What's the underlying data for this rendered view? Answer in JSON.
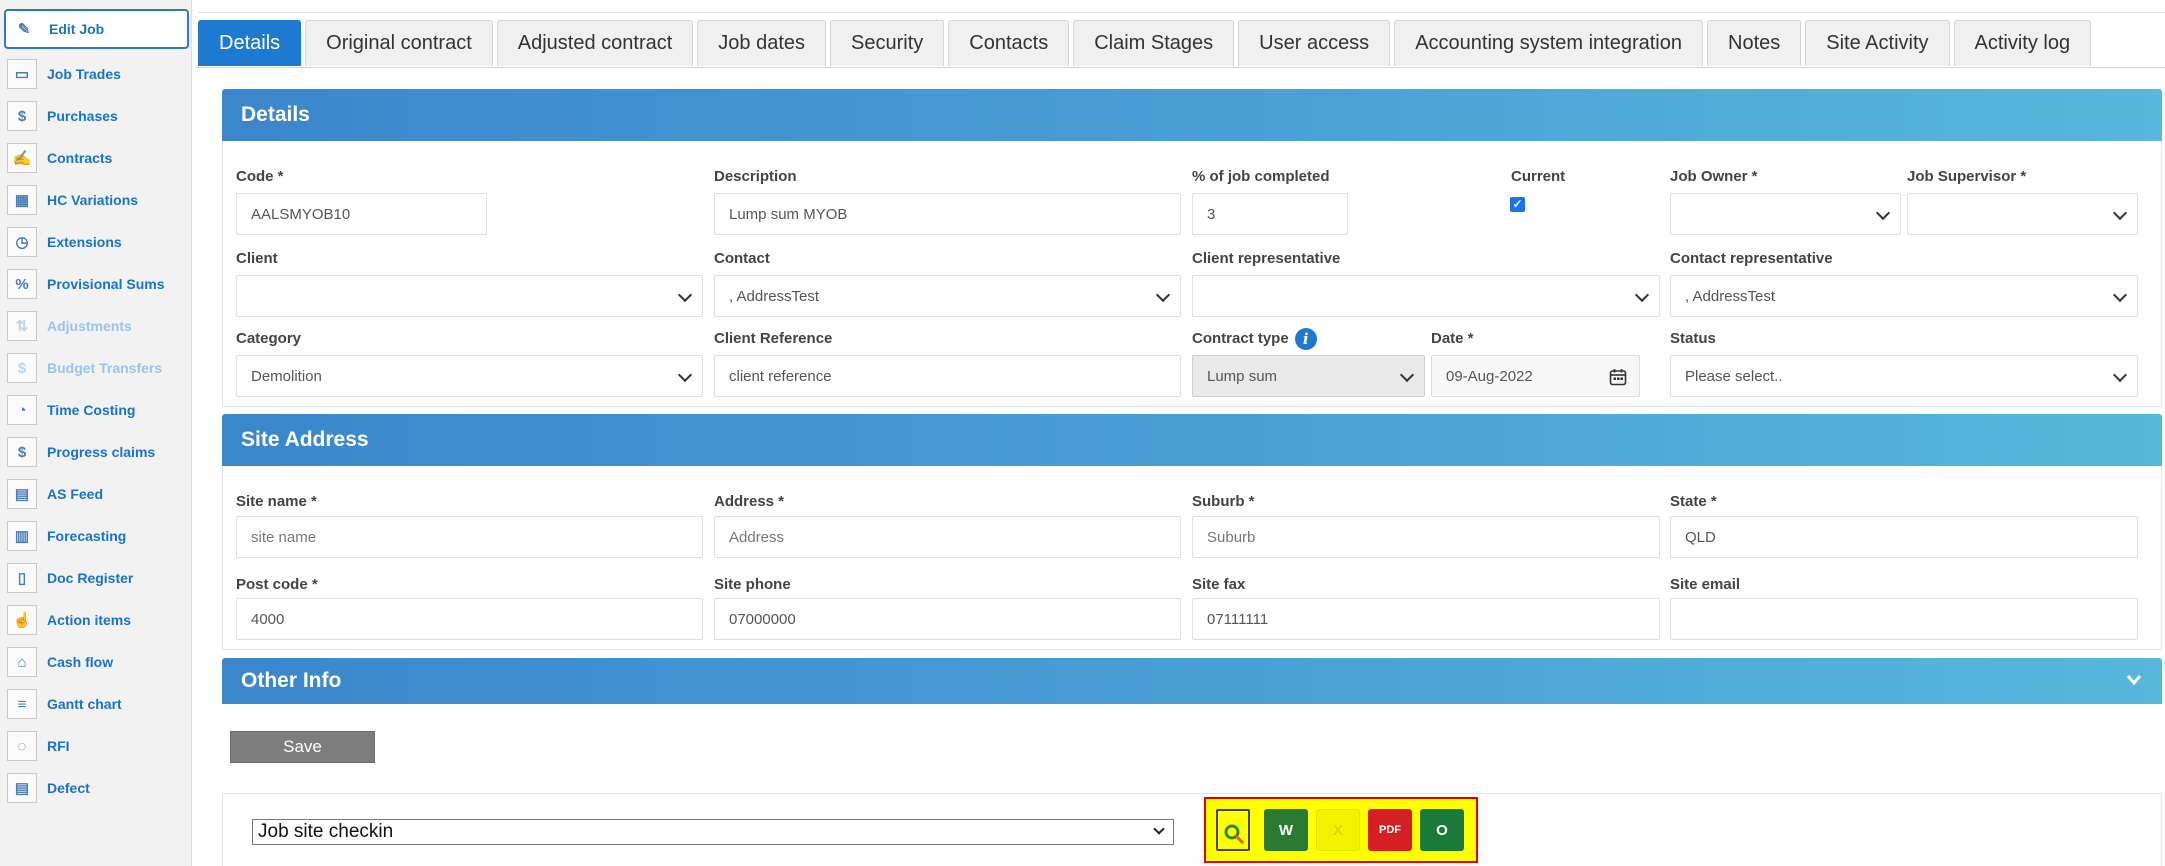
{
  "sidebar": {
    "items": [
      {
        "label": "Edit Job",
        "icon": "pencil-icon",
        "glyph": "✎"
      },
      {
        "label": "Job Trades",
        "icon": "folder-icon",
        "glyph": "▭"
      },
      {
        "label": "Purchases",
        "icon": "coins-icon",
        "glyph": "$"
      },
      {
        "label": "Contracts",
        "icon": "contract-icon",
        "glyph": "✍"
      },
      {
        "label": "HC Variations",
        "icon": "variations-icon",
        "glyph": "▦"
      },
      {
        "label": "Extensions",
        "icon": "clock-icon",
        "glyph": "◷"
      },
      {
        "label": "Provisional Sums",
        "icon": "sums-icon",
        "glyph": "%"
      },
      {
        "label": "Adjustments",
        "icon": "adjust-icon",
        "glyph": "⇅"
      },
      {
        "label": "Budget Transfers",
        "icon": "transfer-icon",
        "glyph": "$"
      },
      {
        "label": "Time Costing",
        "icon": "time-costing-icon",
        "glyph": "◔"
      },
      {
        "label": "Progress claims",
        "icon": "claims-icon",
        "glyph": "$"
      },
      {
        "label": "AS Feed",
        "icon": "feed-icon",
        "glyph": "▤"
      },
      {
        "label": "Forecasting",
        "icon": "forecast-chart-icon",
        "glyph": "▥"
      },
      {
        "label": "Doc Register",
        "icon": "document-icon",
        "glyph": "▯"
      },
      {
        "label": "Action items",
        "icon": "action-icon",
        "glyph": "☝"
      },
      {
        "label": "Cash flow",
        "icon": "cash-icon",
        "glyph": "⌂"
      },
      {
        "label": "Gantt chart",
        "icon": "gantt-icon",
        "glyph": "≡"
      },
      {
        "label": "RFI",
        "icon": "rfi-icon",
        "glyph": "◌"
      },
      {
        "label": "Defect",
        "icon": "defect-icon",
        "glyph": "▤"
      }
    ]
  },
  "tabs": [
    "Details",
    "Original contract",
    "Adjusted contract",
    "Job dates",
    "Security",
    "Contacts",
    "Claim Stages",
    "User access",
    "Accounting system integration",
    "Notes",
    "Site Activity",
    "Activity log"
  ],
  "details": {
    "title": "Details",
    "code_label": "Code *",
    "code_value": "AALSMYOB10",
    "description_label": "Description",
    "description_value": "Lump sum MYOB",
    "percent_label": "% of job completed",
    "percent_value": "3",
    "current_label": "Current",
    "current_checked": true,
    "owner_label": "Job Owner *",
    "owner_value": "",
    "supervisor_label": "Job Supervisor *",
    "supervisor_value": "",
    "client_label": "Client",
    "client_value": "",
    "contact_label": "Contact",
    "contact_value": ", AddressTest",
    "client_rep_label": "Client representative",
    "client_rep_value": "",
    "contact_rep_label": "Contact representative",
    "contact_rep_value": ", AddressTest",
    "category_label": "Category",
    "category_value": "Demolition",
    "client_ref_label": "Client Reference",
    "client_ref_value": "client reference",
    "contract_type_label": "Contract type",
    "contract_type_value": "Lump sum",
    "date_label": "Date *",
    "date_value": "09-Aug-2022",
    "status_label": "Status",
    "status_value": "Please select.."
  },
  "site": {
    "title": "Site Address",
    "site_name_label": "Site name *",
    "site_name_placeholder": "site name",
    "address_label": "Address *",
    "address_placeholder": "Address",
    "suburb_label": "Suburb *",
    "suburb_placeholder": "Suburb",
    "state_label": "State *",
    "state_value": "QLD",
    "postcode_label": "Post code *",
    "postcode_value": "4000",
    "phone_label": "Site phone",
    "phone_value": "07000000",
    "fax_label": "Site fax",
    "fax_value": "07111111",
    "email_label": "Site email",
    "email_value": ""
  },
  "other": {
    "title": "Other Info"
  },
  "save_label": "Save",
  "checkin": {
    "selected": "Job site checkin"
  },
  "exports": {
    "word": "W",
    "excel": "X",
    "pdf": "PDF",
    "outlook": "O"
  },
  "colors": {
    "accent": "#1e7ad0",
    "panel_gradient_start": "#3b86cc",
    "panel_gradient_end": "#58b7dc",
    "export_highlight": "#ffff00",
    "export_border": "#e00000"
  }
}
